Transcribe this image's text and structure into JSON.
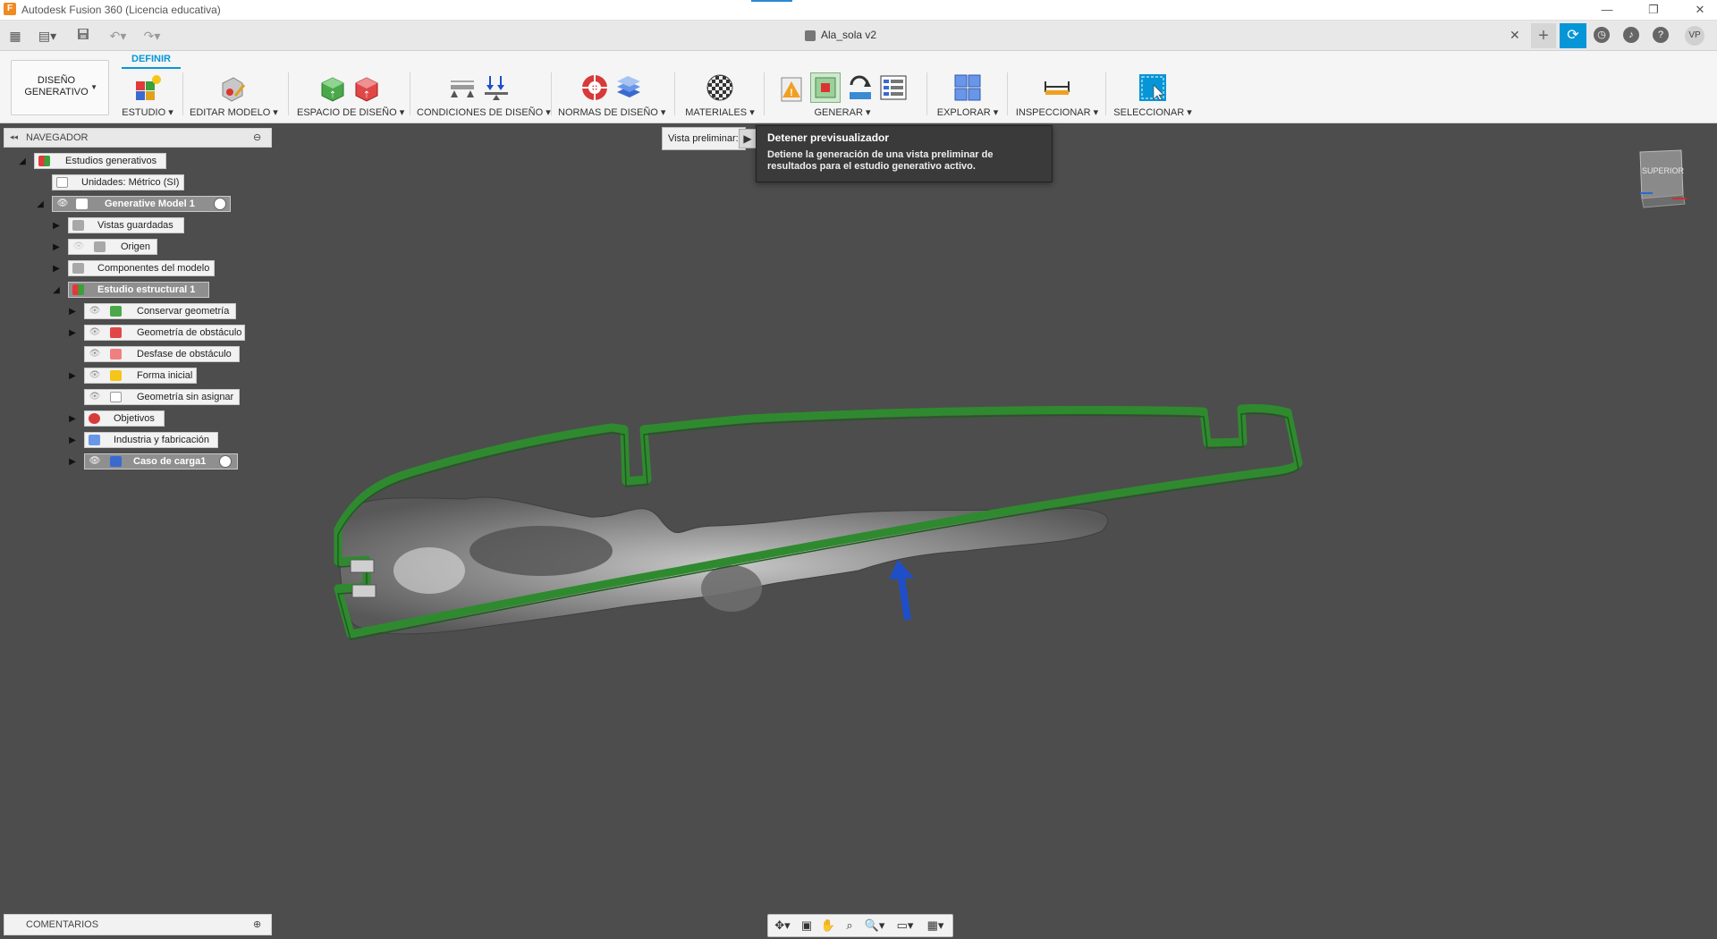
{
  "app": {
    "window_title": "Autodesk Fusion 360 (Licencia educativa)",
    "logo_letter": "F"
  },
  "window_controls": {
    "minimize": "—",
    "restore": "❐",
    "close": "✕"
  },
  "document": {
    "tab_title": "Ala_sola v2",
    "close_glyph": "✕",
    "add_glyph": "+",
    "user_initials": "VP"
  },
  "quick_access": {
    "grid": "▦",
    "file": "▤▾",
    "save": "💾",
    "undo": "↶▾",
    "redo": "↷▾"
  },
  "toolbar": {
    "workspace": "DISEÑO\nGENERATIVO",
    "active_tab": "DEFINIR",
    "groups": [
      {
        "label": "ESTUDIO ▾"
      },
      {
        "label": "EDITAR MODELO ▾"
      },
      {
        "label": "ESPACIO DE DISEÑO ▾"
      },
      {
        "label": "CONDICIONES DE DISEÑO ▾"
      },
      {
        "label": "NORMAS DE DISEÑO ▾"
      },
      {
        "label": "MATERIALES ▾"
      },
      {
        "label": "GENERAR ▾"
      },
      {
        "label": "EXPLORAR ▾"
      },
      {
        "label": "INSPECCIONAR ▾"
      },
      {
        "label": "SELECCIONAR ▾"
      }
    ]
  },
  "navigator": {
    "title": "NAVEGADOR",
    "items": [
      {
        "label": "Estudios generativos"
      },
      {
        "label": "Unidades: Métrico (SI)"
      },
      {
        "label": "Generative Model 1"
      },
      {
        "label": "Vistas guardadas"
      },
      {
        "label": "Origen"
      },
      {
        "label": "Componentes del modelo"
      },
      {
        "label": "Estudio estructural 1"
      },
      {
        "label": "Conservar geometría"
      },
      {
        "label": "Geometría de obstáculo"
      },
      {
        "label": "Desfase de obstáculo"
      },
      {
        "label": "Forma inicial"
      },
      {
        "label": "Geometría sin asignar"
      },
      {
        "label": "Objetivos"
      },
      {
        "label": "Industria y fabricación"
      },
      {
        "label": "Caso de carga1"
      }
    ]
  },
  "preview": {
    "label": "Vista preliminar:",
    "play_glyph": "▶"
  },
  "tooltip": {
    "title": "Detener previsualizador",
    "body": "Detiene la generación de una vista preliminar de resultados para el estudio generativo activo."
  },
  "viewcube": {
    "face": "SUPERIOR"
  },
  "comments": {
    "title": "COMENTARIOS"
  },
  "colors": {
    "accent": "#0696d7",
    "viewport_bg": "#4d4d4d",
    "wing_outline": "#2f8a2f",
    "load_arrow": "#1f4fc8"
  }
}
